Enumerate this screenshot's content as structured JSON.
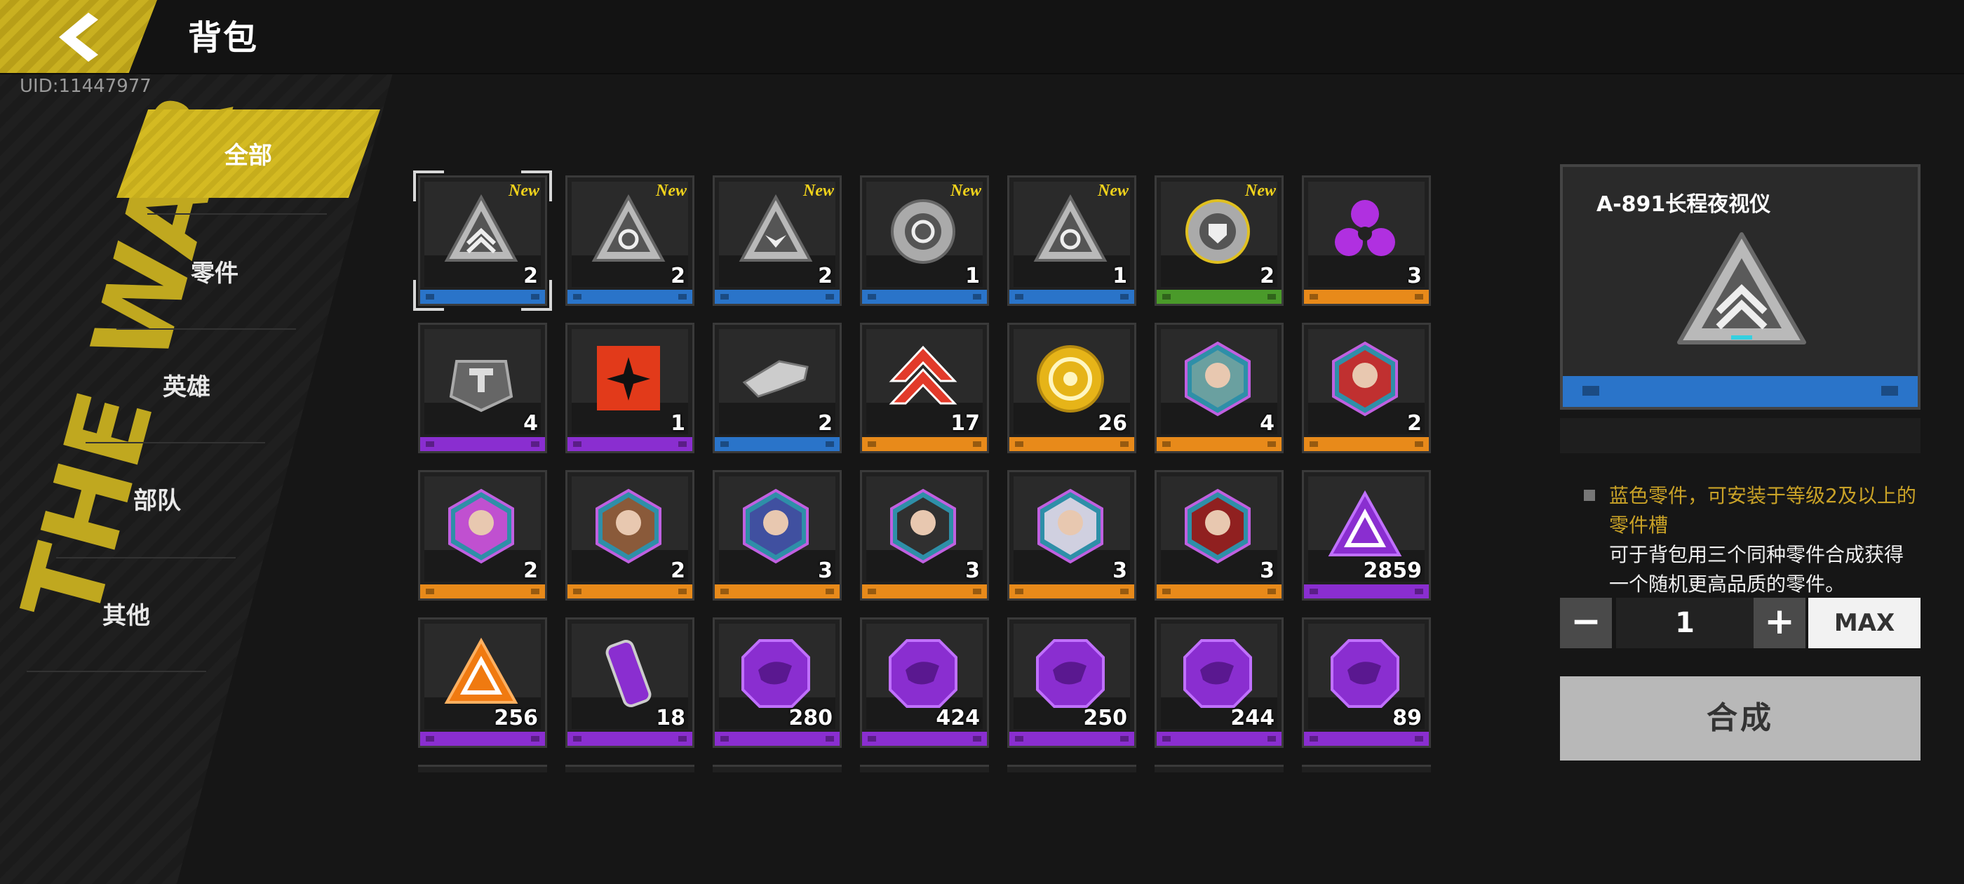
{
  "header": {
    "title": "背包",
    "uid": "UID:11447977"
  },
  "background_text": "THE WAR",
  "sidebar": {
    "items": [
      {
        "label": "全部",
        "active": true
      },
      {
        "label": "零件",
        "active": false
      },
      {
        "label": "英雄",
        "active": false
      },
      {
        "label": "部队",
        "active": false
      },
      {
        "label": "其他",
        "active": false
      }
    ]
  },
  "colors": {
    "blue": "#2a74c9",
    "purple": "#8a2ed0",
    "orange": "#e88a1a",
    "green": "#4a9a2a",
    "accent": "#d4ba22"
  },
  "grid": {
    "new_label": "New",
    "items": [
      {
        "name": "part-triangle-chevron",
        "count": "2",
        "rarity": "blue",
        "new": true,
        "icon": "tri-chevron"
      },
      {
        "name": "part-triangle-gear",
        "count": "2",
        "rarity": "blue",
        "new": true,
        "icon": "tri-gear"
      },
      {
        "name": "part-triangle-wing",
        "count": "2",
        "rarity": "blue",
        "new": true,
        "icon": "tri-wing"
      },
      {
        "name": "part-round-cycle",
        "count": "1",
        "rarity": "blue",
        "new": true,
        "icon": "round-cycle"
      },
      {
        "name": "part-triangle-cycle",
        "count": "1",
        "rarity": "blue",
        "new": true,
        "icon": "tri-cycle"
      },
      {
        "name": "part-round-shield",
        "count": "2",
        "rarity": "green",
        "new": true,
        "icon": "round-shield"
      },
      {
        "name": "purple-emblem",
        "count": "3",
        "rarity": "orange",
        "new": false,
        "icon": "purple-trefoil"
      },
      {
        "name": "parts-box",
        "count": "4",
        "rarity": "purple",
        "new": false,
        "icon": "parts-box"
      },
      {
        "name": "red-banner",
        "count": "1",
        "rarity": "purple",
        "new": false,
        "icon": "red-banner"
      },
      {
        "name": "weapon-part",
        "count": "2",
        "rarity": "blue",
        "new": false,
        "icon": "weapon"
      },
      {
        "name": "rank-up-arrows",
        "count": "17",
        "rarity": "orange",
        "new": false,
        "icon": "red-chevrons"
      },
      {
        "name": "gold-coin",
        "count": "26",
        "rarity": "orange",
        "new": false,
        "icon": "gold-coin"
      },
      {
        "name": "hero-token-1",
        "count": "4",
        "rarity": "orange",
        "new": false,
        "icon": "hero-hex-teal"
      },
      {
        "name": "hero-token-2",
        "count": "2",
        "rarity": "orange",
        "new": false,
        "icon": "hero-hex-red"
      },
      {
        "name": "hero-token-3",
        "count": "2",
        "rarity": "orange",
        "new": false,
        "icon": "hero-hex-pink"
      },
      {
        "name": "hero-token-4",
        "count": "2",
        "rarity": "orange",
        "new": false,
        "icon": "hero-hex-brown"
      },
      {
        "name": "hero-token-5",
        "count": "3",
        "rarity": "orange",
        "new": false,
        "icon": "hero-hex-blue"
      },
      {
        "name": "hero-token-6",
        "count": "3",
        "rarity": "orange",
        "new": false,
        "icon": "hero-hex-black"
      },
      {
        "name": "hero-token-7",
        "count": "3",
        "rarity": "orange",
        "new": false,
        "icon": "hero-hex-white"
      },
      {
        "name": "hero-token-8",
        "count": "3",
        "rarity": "orange",
        "new": false,
        "icon": "hero-hex-darkred"
      },
      {
        "name": "purple-triangle",
        "count": "2859",
        "rarity": "purple",
        "new": false,
        "icon": "purple-triangle"
      },
      {
        "name": "orange-triangle",
        "count": "256",
        "rarity": "purple",
        "new": false,
        "icon": "orange-triangle"
      },
      {
        "name": "purple-canister",
        "count": "18",
        "rarity": "purple",
        "new": false,
        "icon": "canister"
      },
      {
        "name": "purple-badge-1",
        "count": "280",
        "rarity": "purple",
        "new": false,
        "icon": "purple-octagon"
      },
      {
        "name": "purple-badge-2",
        "count": "424",
        "rarity": "purple",
        "new": false,
        "icon": "purple-octagon"
      },
      {
        "name": "purple-badge-3",
        "count": "250",
        "rarity": "purple",
        "new": false,
        "icon": "purple-octagon"
      },
      {
        "name": "purple-badge-4",
        "count": "244",
        "rarity": "purple",
        "new": false,
        "icon": "purple-octagon"
      },
      {
        "name": "purple-badge-5",
        "count": "89",
        "rarity": "purple",
        "new": false,
        "icon": "purple-octagon"
      }
    ]
  },
  "detail": {
    "item_name": "A-891长程夜视仪",
    "rarity": "blue",
    "desc_rarity": "蓝色零件，可安装于等级2及以上的零件槽",
    "desc_usage": "可于背包用三个同种零件合成获得一个随机更高品质的零件。",
    "quantity": "1",
    "minus_label": "−",
    "plus_label": "+",
    "max_label": "MAX",
    "craft_label": "合成"
  }
}
